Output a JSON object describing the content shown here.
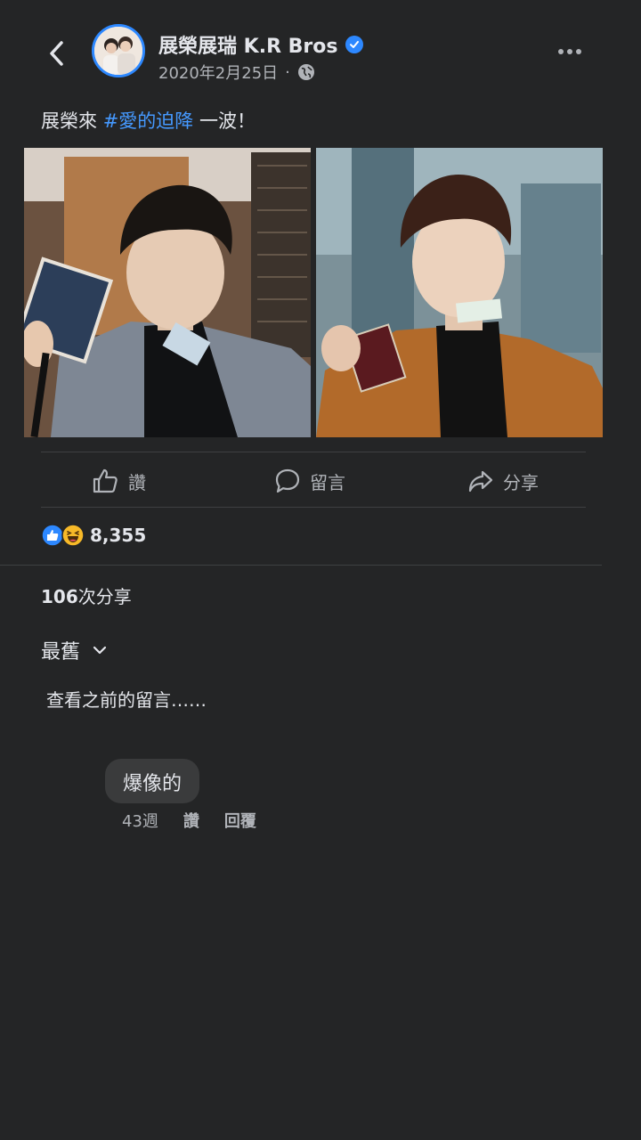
{
  "header": {
    "page_name": "展榮展瑞 K.R Bros",
    "date": "2020年2月25日",
    "date_separator": "·",
    "icons": {
      "back": "chevron-left-icon",
      "verified": "verified-badge-icon",
      "privacy": "globe-icon",
      "more": "more-horizontal-icon"
    }
  },
  "post": {
    "caption_prefix": "展榮來 ",
    "hashtag": "#愛的迫降",
    "caption_suffix": " 一波！",
    "photos": [
      "photo-left",
      "photo-right"
    ]
  },
  "actions": {
    "like_label": "讚",
    "comment_label": "留言",
    "share_label": "分享"
  },
  "reactions": {
    "count": "8,355",
    "types": [
      "like",
      "haha"
    ]
  },
  "shares": {
    "count": "106",
    "label": "次分享"
  },
  "comments": {
    "sort_label": "最舊",
    "view_previous": "查看之前的留言……",
    "items": [
      {
        "text": "爆像的",
        "age": "43週",
        "like_label": "讚",
        "reply_label": "回覆"
      }
    ]
  },
  "colors": {
    "background": "#242526",
    "accent": "#2d88ff",
    "hashtag": "#4599ff",
    "text_primary": "#e4e6eb",
    "text_secondary": "#b0b3b8"
  }
}
